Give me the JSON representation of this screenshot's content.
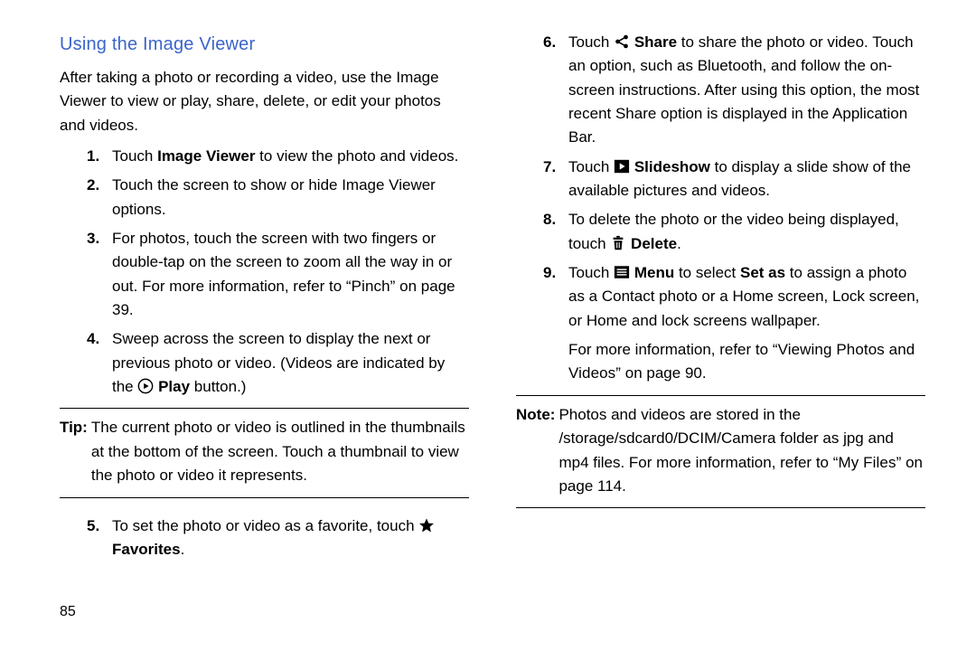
{
  "heading": "Using the Image Viewer",
  "intro": "After taking a photo or recording a video, use the Image Viewer to view or play, share, delete, or edit your photos and videos.",
  "left": {
    "steps": [
      {
        "num": "1.",
        "pre": "Touch ",
        "bold": "Image Viewer",
        "post": " to view the photo and videos."
      },
      {
        "num": "2.",
        "text": "Touch the screen to show or hide Image Viewer options."
      },
      {
        "num": "3.",
        "text_a": "For photos, touch the screen with two fingers or double-tap on the screen to zoom all the way in or out. For more information, refer to ",
        "text_ref": "“Pinch”",
        "text_b": " on page 39."
      },
      {
        "num": "4.",
        "text_a": "Sweep across the screen to display the next or previous photo or video. (Videos are indicated by the ",
        "bold": "Play",
        "post": " button.)"
      }
    ],
    "tip_label": "Tip:",
    "tip_body": "The current photo or video is outlined in the thumbnails at the bottom of the screen. Touch a thumbnail to view the photo or video it represents.",
    "step5": {
      "num": "5.",
      "text_a": "To set the photo or video as a favorite, touch ",
      "bold": "Favorites",
      "post": "."
    }
  },
  "right": {
    "steps": [
      {
        "num": "6.",
        "text_a": "Touch ",
        "bold": "Share",
        "text_b": " to share the photo or video. Touch an option, such as Bluetooth, and follow the on-screen instructions. After using this option, the most recent Share option is displayed in the Application Bar."
      },
      {
        "num": "7.",
        "text_a": "Touch ",
        "bold": "Slideshow",
        "text_b": " to display a slide show of the available pictures and videos."
      },
      {
        "num": "8.",
        "text_a": "To delete the photo or the video being displayed, touch ",
        "bold": "Delete",
        "post": "."
      },
      {
        "num": "9.",
        "text_a": "Touch ",
        "bold1": "Menu",
        "mid": " to select ",
        "bold2": "Set as",
        "text_b": " to assign a photo as a Contact photo or a Home screen, Lock screen, or Home and lock screens wallpaper."
      }
    ],
    "more_info": {
      "a": "For more information, refer to ",
      "ref": "“Viewing Photos and Videos”",
      "b": " on page 90."
    },
    "note_label": "Note:",
    "note_body_a": "Photos and videos are stored in the /storage/sdcard0/DCIM/Camera folder as jpg and mp4 files. For more information, refer to ",
    "note_ref": "“My Files”",
    "note_body_b": " on page 114."
  },
  "page_number": "85"
}
